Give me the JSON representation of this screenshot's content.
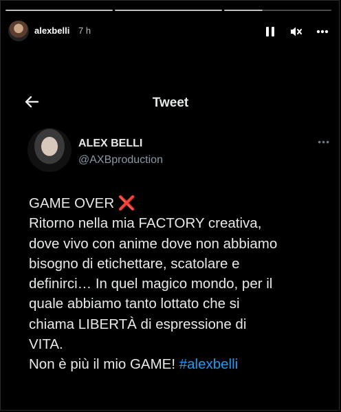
{
  "story": {
    "username": "alexbelli",
    "time": "7 h"
  },
  "tweet_view": {
    "title": "Tweet"
  },
  "author": {
    "name": "ALEX BELLI",
    "handle": "@AXBproduction",
    "more_label": "•••"
  },
  "tweet": {
    "lines": [
      "GAME OVER ",
      "Ritorno nella mia FACTORY creativa,",
      "dove vivo con anime dove non abbiamo",
      "bisogno di etichettare, scatolare e",
      "definirci… In quel magico mondo, per il",
      "quale abbiamo tanto lottato che si",
      "chiama LIBERTÀ di espressione di",
      "VITA.",
      "Non è più il mio GAME! "
    ],
    "cross_emoji": "❌",
    "hashtag": "#alexbelli"
  },
  "colors": {
    "background": "#000000",
    "text": "#e7e9ea",
    "secondary": "#8b98a5",
    "hashtag": "#1d9bf0",
    "cross": "#e8283c"
  },
  "icons": [
    "pause-icon",
    "mute-icon",
    "more-icon",
    "back-arrow-icon"
  ]
}
